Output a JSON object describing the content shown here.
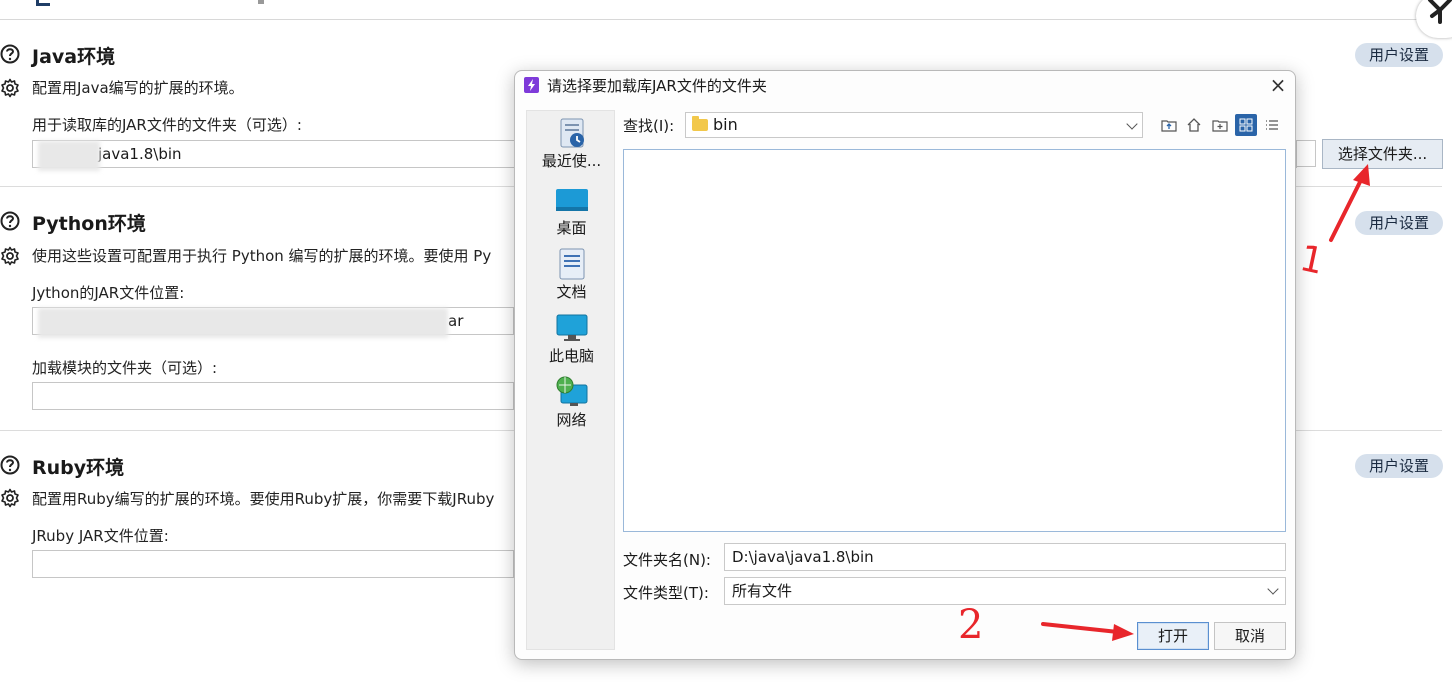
{
  "sections": {
    "java": {
      "title": "Java环境",
      "description": "配置用Java编写的扩展的环境。",
      "field_label": "用于读取库的JAR文件的文件夹（可选）:",
      "field_value": "java1.8\\bin",
      "user_settings": "用户设置",
      "choose_button": "选择文件夹..."
    },
    "python": {
      "title": "Python环境",
      "description": "使用这些设置可配置用于执行 Python 编写的扩展的环境。要使用 Py",
      "jar_label": "Jython的JAR文件位置:",
      "jar_value": "ar",
      "modules_label": "加载模块的文件夹（可选）:",
      "user_settings": "用户设置"
    },
    "ruby": {
      "title": "Ruby环境",
      "description": "配置用Ruby编写的扩展的环境。要使用Ruby扩展，你需要下载JRuby",
      "jar_label": "JRuby JAR文件位置:",
      "user_settings": "用户设置"
    }
  },
  "dialog": {
    "title": "请选择要加载库JAR文件的文件夹",
    "close": "×",
    "places": [
      {
        "label": "最近使...",
        "icon": "recent-icon"
      },
      {
        "label": "桌面",
        "icon": "desktop-icon"
      },
      {
        "label": "文档",
        "icon": "documents-icon"
      },
      {
        "label": "此电脑",
        "icon": "computer-icon"
      },
      {
        "label": "网络",
        "icon": "network-icon"
      }
    ],
    "look_in_label": "查找(I):",
    "look_in_value": "bin",
    "folder_name_label": "文件夹名(N):",
    "folder_name_value": "D:\\java\\java1.8\\bin",
    "file_type_label": "文件类型(T):",
    "file_type_value": "所有文件",
    "open_button": "打开",
    "cancel_button": "取消"
  },
  "annotations": {
    "mark_1": "1",
    "mark_2": "2",
    "color": "#e8262b"
  },
  "colors": {
    "pill_bg": "#d6e0ec",
    "accent": "#2a64a8",
    "title_icon": "#7e3ad9"
  }
}
